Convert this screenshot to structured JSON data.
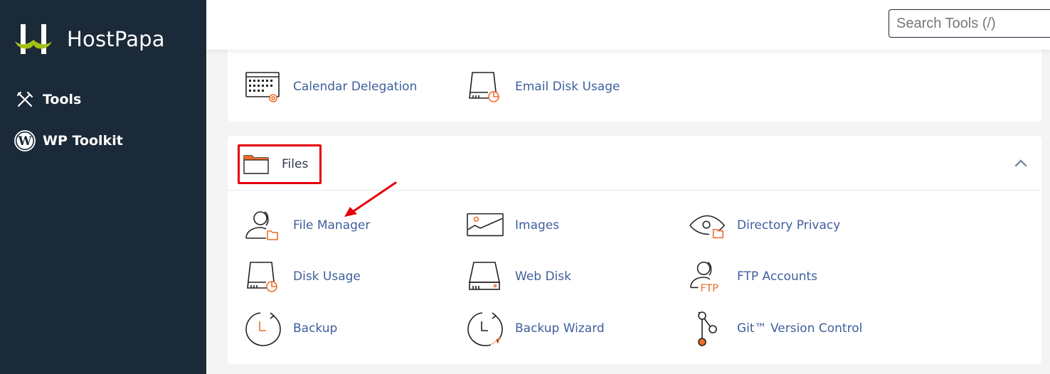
{
  "brand": {
    "name": "HostPapa",
    "logo_accent": "#a3c114"
  },
  "sidebar": {
    "items": [
      {
        "label": "Tools",
        "icon": "tools-icon"
      },
      {
        "label": "WP Toolkit",
        "icon": "wordpress-icon"
      }
    ]
  },
  "header": {
    "search": {
      "placeholder": "Search Tools (/)",
      "value": ""
    }
  },
  "colors": {
    "sidebar_bg": "#1b2a38",
    "link": "#3d5f9c",
    "icon_accent": "#f26b2a",
    "highlight_annotation": "#e3000b"
  },
  "email_section": {
    "tools": [
      {
        "label": "Calendar Delegation",
        "icon": "calendar-gear-icon"
      },
      {
        "label": "Email Disk Usage",
        "icon": "disk-usage-icon"
      }
    ]
  },
  "files_section": {
    "title": "Files",
    "icon": "folder-icon",
    "collapse_icon": "chevron-up-icon",
    "tools": [
      {
        "label": "File Manager",
        "icon": "user-folder-icon"
      },
      {
        "label": "Images",
        "icon": "image-icon"
      },
      {
        "label": "Directory Privacy",
        "icon": "eye-folder-icon"
      },
      {
        "label": "Disk Usage",
        "icon": "disk-usage-icon"
      },
      {
        "label": "Web Disk",
        "icon": "hard-drive-icon"
      },
      {
        "label": "FTP Accounts",
        "icon": "ftp-user-icon",
        "icon_text": "FTP"
      },
      {
        "label": "Backup",
        "icon": "backup-clock-icon"
      },
      {
        "label": "Backup Wizard",
        "icon": "backup-wizard-icon"
      },
      {
        "label": "Git™ Version Control",
        "icon": "git-branch-icon"
      }
    ]
  }
}
